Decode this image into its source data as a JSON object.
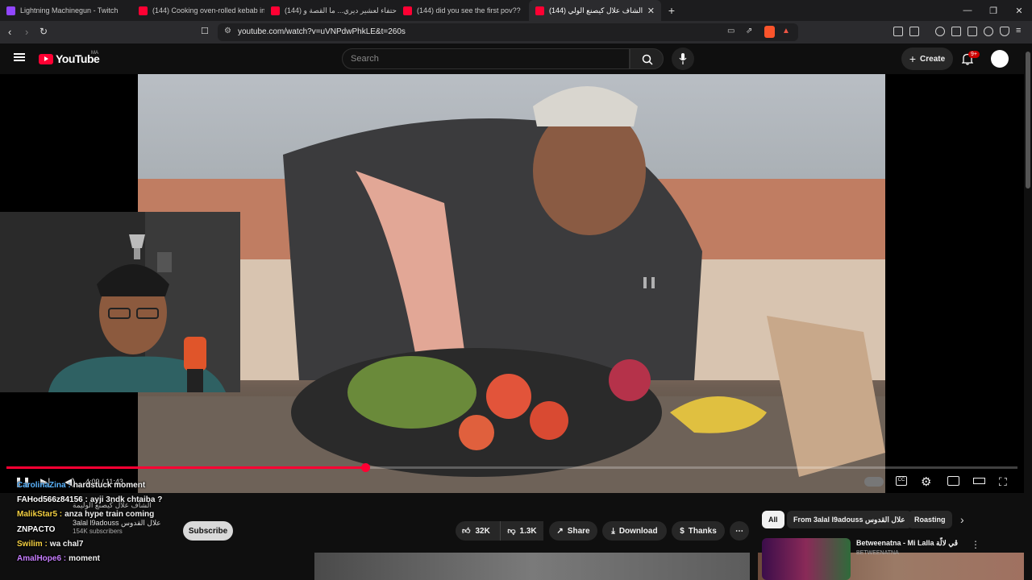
{
  "browser": {
    "tabs": [
      {
        "title": "Lightning Machinegun - Twitch",
        "favicon": "twitch-icon"
      },
      {
        "title": "(144) Cooking oven-rolled kebab in",
        "favicon": "youtube-icon"
      },
      {
        "title": "(144) احتفاء لعشير ديري... ما القصة و",
        "favicon": "youtube-icon"
      },
      {
        "title": "(144) did you see the first pov??",
        "favicon": "youtube-icon"
      },
      {
        "title": "(144) الشاف علال كيصنع الولي",
        "favicon": "youtube-icon",
        "active": true
      }
    ],
    "url": "youtube.com/watch?v=uVNPdwPhkLE&t=260s"
  },
  "masthead": {
    "logo_text": "YouTube",
    "country_code": "MA",
    "search_placeholder": "Search",
    "create_label": "Create",
    "notification_count": "9+"
  },
  "player": {
    "time_current": "4:09",
    "time_total": "11:43",
    "time_separator": "/",
    "progress_fraction": 0.355
  },
  "chat": [
    {
      "user": "CarolinaZina",
      "message": "hardstuck moment",
      "color": "#5ab4ff"
    },
    {
      "user": "FAHod566z84156",
      "message": "ayji 3ndk chtaiba ?",
      "color": "#ffffff"
    },
    {
      "user": "MalikStar5",
      "message": "anza hype train coming",
      "color": "#f5d142"
    },
    {
      "user": "ZNPACTO",
      "message": "",
      "color": "#ffffff"
    },
    {
      "user": "Swilim",
      "message": "wa chal7",
      "color": "#f5d142"
    },
    {
      "user": "AmalHope6",
      "message": "moment",
      "color": "#c77dff"
    }
  ],
  "video_info": {
    "title_fragment": "الشاف علال كيصنع الوليمة",
    "channel_name": "3alal l9adouss علال القدوس",
    "subscribers": "154K subscribers",
    "subscribe_label": "Subscribe",
    "likes": "32K",
    "dislikes": "1.3K",
    "share_label": "Share",
    "download_label": "Download",
    "thanks_label": "Thanks",
    "more_label": "⋯"
  },
  "sidebar": {
    "chips": [
      "All",
      "From 3alal l9adouss علال القدوس",
      "Roasting"
    ],
    "recommendation": {
      "title": "Betweenatna - Mi Lalla ڨي لالّة",
      "channel": "BETWEENATNA"
    }
  }
}
